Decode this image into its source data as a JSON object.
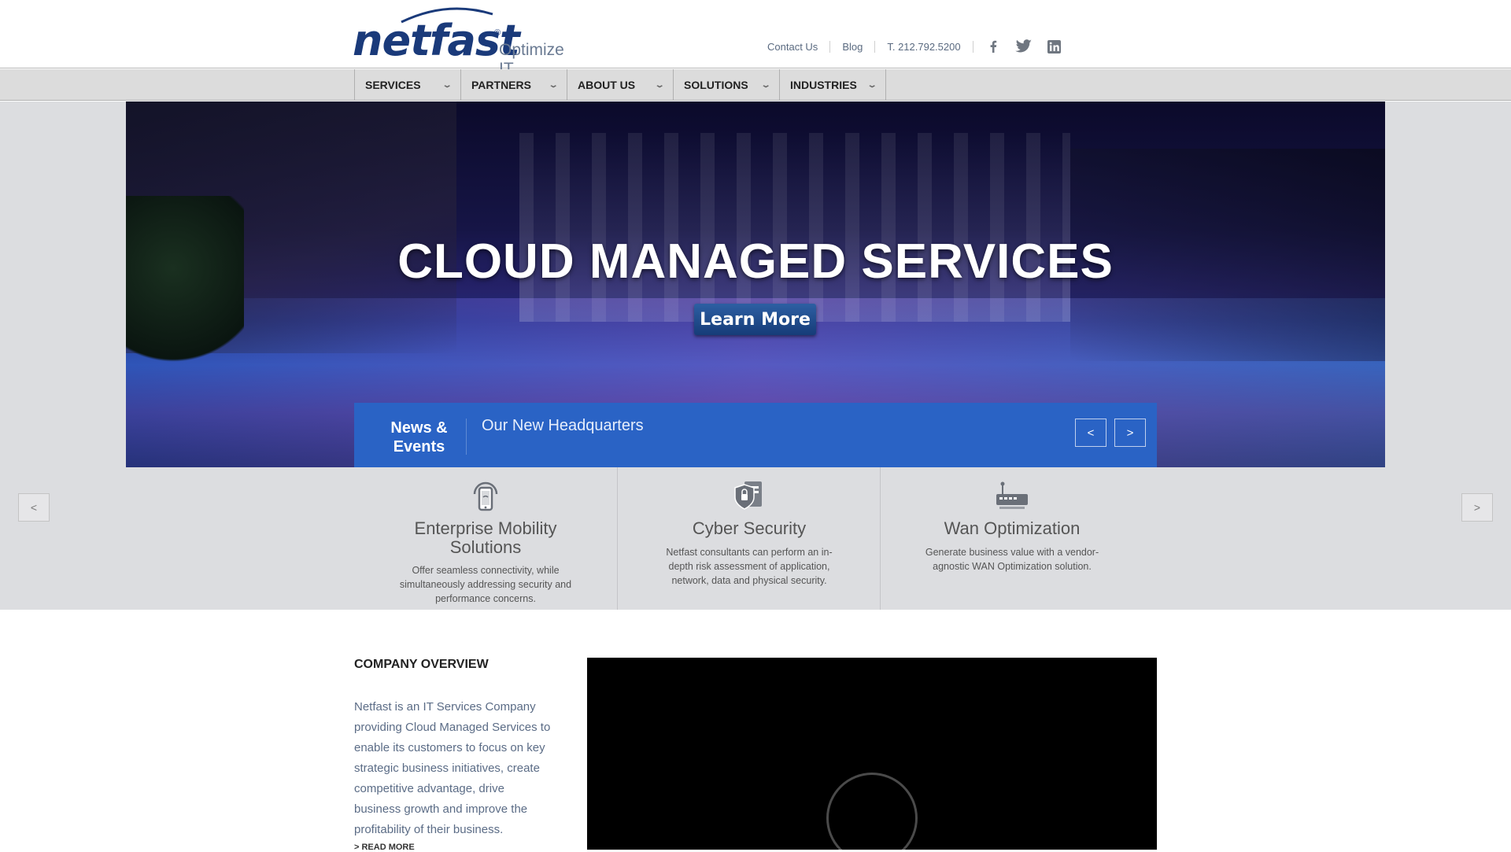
{
  "header": {
    "logo_text": "netfast",
    "logo_registered": "®",
    "logo_tagline": "Optimize IT",
    "links": [
      "Contact Us",
      "Blog",
      "T. 212.792.5200"
    ],
    "social": [
      {
        "icon": "facebook-icon",
        "glyph": "f"
      },
      {
        "icon": "twitter-icon",
        "glyph": "t"
      },
      {
        "icon": "linkedin-icon",
        "glyph": "in"
      }
    ]
  },
  "nav": {
    "items": [
      "SERVICES",
      "PARTNERS",
      "ABOUT US",
      "SOLUTIONS",
      "INDUSTRIES"
    ]
  },
  "hero": {
    "title": "CLOUD MANAGED SERVICES",
    "button": "Learn More"
  },
  "news": {
    "label_line1": "News &",
    "label_line2": "Events",
    "headline": "Our New Headquarters",
    "prev": "<",
    "next": ">"
  },
  "carousel": {
    "prev": "<",
    "next": ">"
  },
  "features": [
    {
      "icon": "mobile-phone-icon",
      "title_line1": "Enterprise Mobility",
      "title_line2": "Solutions",
      "desc": "Offer seamless connectivity, while simultaneously addressing security and performance concerns."
    },
    {
      "icon": "shield-icon",
      "title_line1": "Cyber Security",
      "title_line2": "",
      "desc": "Netfast consultants can perform an in-depth risk assessment of application, network, data and physical security."
    },
    {
      "icon": "router-icon",
      "title_line1": "Wan Optimization",
      "title_line2": "",
      "desc": "Generate business value with a vendor-agnostic WAN Optimization solution."
    }
  ],
  "overview": {
    "title": "COMPANY OVERVIEW",
    "text": "Netfast is an IT Services Company providing Cloud Managed Services to enable its customers to focus on key strategic business initiatives, create competitive advantage, drive business growth and improve the profitability of their business.",
    "read_more": "> READ MORE"
  },
  "colors": {
    "brand": "#1a3a7a",
    "news_bar": "#2a63c5",
    "nav_bg": "#dcdcdc"
  }
}
